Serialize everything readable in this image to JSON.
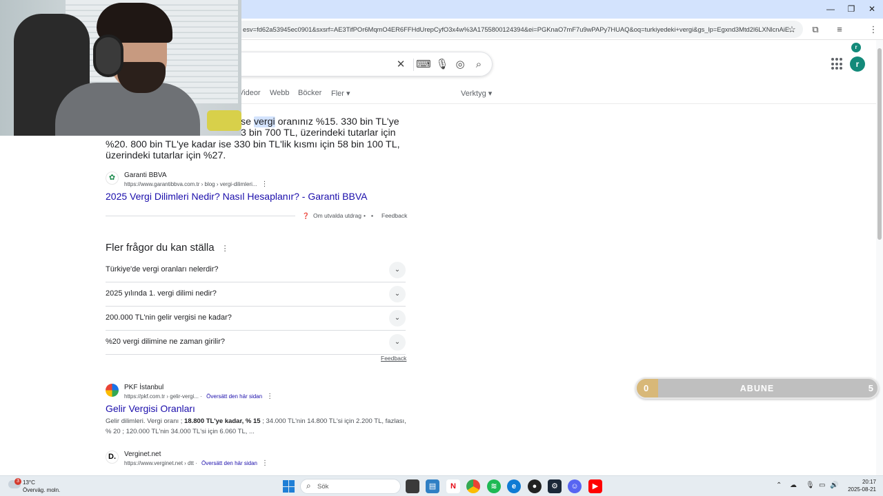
{
  "browser": {
    "address_url": "esv=fd62a53945ec0901&sxsrf=AE3TifPOr6MqmO4ER6FFHdUrepCyfO3x4w%3A1755800124394&ei=PGKnaO7mF7u9wPAPy7HUAQ&oq=turkiyedeki+vergi&gs_lp=Egxnd3Mtd2l6LXNlcnAiE...",
    "profile_initial": "r",
    "window_controls": {
      "minimize": "—",
      "restore": "❐",
      "close": "✕"
    }
  },
  "search": {
    "tabs": [
      "Videor",
      "Webb",
      "Böcker",
      "Fler ▾"
    ],
    "tools": "Verktyg ▾",
    "account_initial": "r"
  },
  "featured_snippet": {
    "line1_pre": "se ",
    "line1_hl": "vergi",
    "line1_post": " oranınız %15. 330 bin TL'ye",
    "line2": "3 bin 700 TL, üzerindeki tutarlar için",
    "line3": "%20. 800 bin TL'ye kadar ise 330 bin TL'lik kısmı için 58 bin 100 TL,",
    "line4": "üzerindeki tutarlar için %27.",
    "source_name": "Garanti BBVA",
    "source_url": "https://www.garantibbva.com.tr › blog › vergi-dilimleri...",
    "title": "2025 Vergi Dilimleri Nedir? Nasıl Hesaplanır? - Garanti BBVA",
    "about": "Om utvalda utdrag",
    "feedback": "Feedback"
  },
  "people_also_ask": {
    "title": "Fler frågor du kan ställa",
    "questions": [
      "Türkiye'de vergi oranları nelerdir?",
      "2025 yılında 1. vergi dilimi nedir?",
      "200.000 TL'nin gelir vergisi ne kadar?",
      "%20 vergi dilimine ne zaman girilir?"
    ],
    "feedback": "Feedback"
  },
  "results": [
    {
      "source_name": "PKF İstanbul",
      "source_url": "https://pkf.com.tr › gelir-vergi...",
      "translate": "Översätt den här sidan",
      "title": "Gelir Vergisi Oranları",
      "desc_a": "Gelir dilimleri. Vergi oranı ; ",
      "desc_b": "18.800 TL'ye kadar, % 15",
      "desc_c": " ; 34.000 TL'nin 14.800 TL'si için 2.200 TL, fazlası,",
      "desc_d": "% 20 ; 120.000 TL'nin 34.000 TL'si için 6.060 TL, ..."
    },
    {
      "source_name": "Verginet.net",
      "source_url": "https://www.verginet.net › dtt",
      "translate": "Översätt den här sidan",
      "favicon_letter": "D."
    }
  ],
  "subscriber_goal": {
    "current": "0",
    "label": "ABUNE",
    "goal": "5",
    "progress_fraction": 0.09
  },
  "taskbar": {
    "weather_temp": "13°C",
    "weather_cond": "Överväg. moln.",
    "weather_badge": "3",
    "search_placeholder": "Sök",
    "time": "20:17",
    "date": "2025-08-21"
  },
  "colors": {
    "link": "#1a0dab",
    "highlight": "#d3e3fd",
    "accent": "#138a7a",
    "subbar": "#bfbfbf"
  }
}
